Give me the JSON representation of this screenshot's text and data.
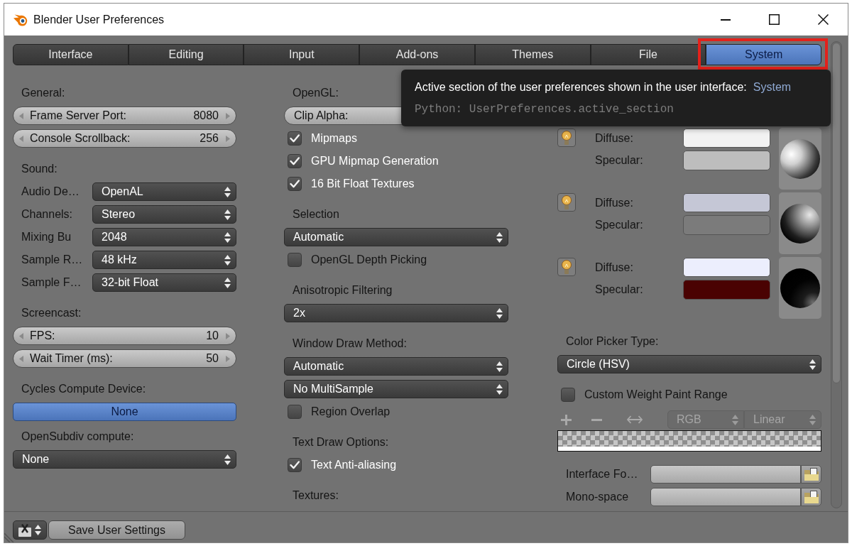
{
  "window": {
    "title": "Blender User Preferences"
  },
  "tabs": [
    {
      "label": "Interface",
      "selected": false,
      "highlighted": false
    },
    {
      "label": "Editing",
      "selected": false,
      "highlighted": false
    },
    {
      "label": "Input",
      "selected": false,
      "highlighted": false
    },
    {
      "label": "Add-ons",
      "selected": false,
      "highlighted": false
    },
    {
      "label": "Themes",
      "selected": false,
      "highlighted": false
    },
    {
      "label": "File",
      "selected": false,
      "highlighted": false
    },
    {
      "label": "System",
      "selected": true,
      "highlighted": true
    }
  ],
  "tooltip": {
    "text": "Active section of the user preferences shown in the user interface:",
    "value": "System",
    "python": "Python: UserPreferences.active_section"
  },
  "columns": [
    {
      "items": [
        {
          "kind": "heading",
          "text": "General:"
        },
        {
          "kind": "number",
          "label": "Frame Server Port:",
          "value": "8080"
        },
        {
          "kind": "number",
          "label": "Console Scrollback:",
          "value": "256"
        },
        {
          "kind": "heading",
          "text": "Sound:"
        },
        {
          "kind": "dropdown",
          "label": "Audio De…",
          "value": "OpenAL"
        },
        {
          "kind": "dropdown",
          "label": "Channels:",
          "value": "Stereo"
        },
        {
          "kind": "dropdown",
          "label": "Mixing Bu",
          "value": "2048"
        },
        {
          "kind": "dropdown",
          "label": "Sample R…",
          "value": "48 kHz"
        },
        {
          "kind": "dropdown",
          "label": "Sample F…",
          "value": "32-bit Float"
        },
        {
          "kind": "heading",
          "text": "Screencast:"
        },
        {
          "kind": "number",
          "label": "FPS:",
          "value": "10"
        },
        {
          "kind": "number",
          "label": "Wait Timer (ms):",
          "value": "50"
        },
        {
          "kind": "heading",
          "text": "Cycles Compute Device:"
        },
        {
          "kind": "toggle",
          "label": "None",
          "selected": true
        },
        {
          "kind": "heading",
          "text": "OpenSubdiv compute:"
        },
        {
          "kind": "dropdown",
          "value": "None"
        }
      ]
    },
    {
      "items": [
        {
          "kind": "heading",
          "text": "OpenGL:"
        },
        {
          "kind": "slider",
          "label": "Clip Alpha:"
        },
        {
          "kind": "checkbox",
          "label": "Mipmaps",
          "checked": true
        },
        {
          "kind": "checkbox",
          "label": "GPU Mipmap Generation",
          "checked": true
        },
        {
          "kind": "checkbox",
          "label": "16 Bit Float Textures",
          "checked": true
        },
        {
          "kind": "heading",
          "text": "Selection"
        },
        {
          "kind": "dropdown",
          "value": "Automatic"
        },
        {
          "kind": "checkbox",
          "label": "OpenGL Depth Picking",
          "checked": false
        },
        {
          "kind": "heading",
          "text": "Anisotropic Filtering"
        },
        {
          "kind": "dropdown",
          "value": "2x"
        },
        {
          "kind": "heading",
          "text": "Window Draw Method:"
        },
        {
          "kind": "dropdown",
          "value": "Automatic"
        },
        {
          "kind": "dropdown",
          "value": "No MultiSample"
        },
        {
          "kind": "checkbox",
          "label": "Region Overlap",
          "checked": false
        },
        {
          "kind": "heading",
          "text": "Text Draw Options:"
        },
        {
          "kind": "checkbox",
          "label": "Text Anti-aliasing",
          "checked": true
        },
        {
          "kind": "heading",
          "text": "Textures:"
        }
      ]
    }
  ],
  "lights": [
    {
      "kind": "left",
      "enabled": true,
      "diffuse": {
        "label": "Diffuse:",
        "color": "#f2f2f2"
      },
      "specular": {
        "label": "Specular:",
        "color": "#bdbdbd"
      }
    },
    {
      "kind": "right",
      "enabled": true,
      "diffuse": {
        "label": "Diffuse:",
        "color": "#c5c7d6"
      },
      "specular": {
        "label": "Specular:",
        "color": "#7b7b7b"
      }
    },
    {
      "kind": "back",
      "enabled": true,
      "diffuse": {
        "label": "Diffuse:",
        "color": "#eceefd"
      },
      "specular": {
        "label": "Specular:",
        "color": "#4a0202"
      }
    }
  ],
  "right_items": [
    {
      "kind": "heading",
      "text": "Color Picker Type:"
    },
    {
      "kind": "dropdown",
      "value": "Circle (HSV)"
    },
    {
      "kind": "checkbox",
      "label": "Custom Weight Paint Range",
      "checked": false
    },
    {
      "kind": "ramp_tools",
      "disabled": true,
      "color_mode": "RGB",
      "interpolation": "Linear"
    },
    {
      "kind": "color_ramp"
    },
    {
      "kind": "file",
      "label": "Interface Fo…"
    },
    {
      "kind": "file",
      "label": "Mono-space"
    }
  ],
  "bottom_bar": {
    "save_button": "Save User Settings"
  }
}
